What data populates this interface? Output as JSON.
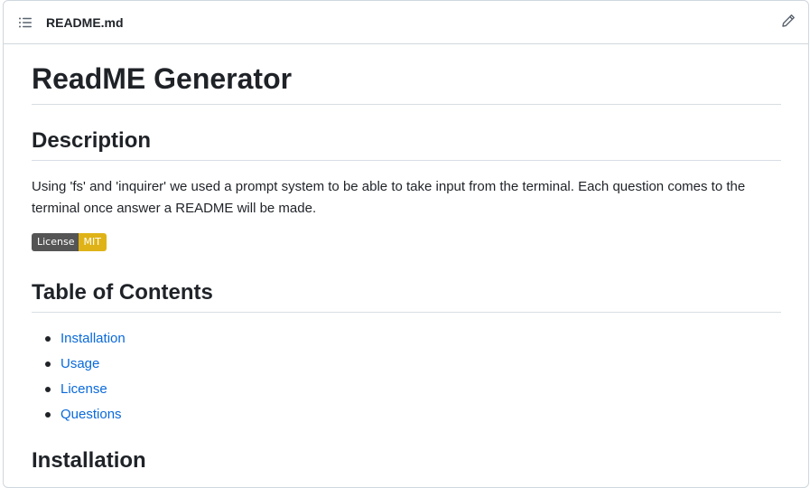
{
  "file_header": {
    "file_name": "README.md",
    "list_icon": "list-unordered-icon",
    "edit_icon": "pencil-icon"
  },
  "readme": {
    "title": "ReadME Generator",
    "description_heading": "Description",
    "description_text": "Using 'fs' and 'inquirer' we used a prompt system to be able to take input from the terminal. Each question comes to the terminal once answer a README will be made.",
    "badge": {
      "label": "License",
      "value": "MIT",
      "label_color": "#555555",
      "value_color": "#dfb317"
    },
    "toc_heading": "Table of Contents",
    "toc_items": [
      {
        "label": "Installation"
      },
      {
        "label": "Usage"
      },
      {
        "label": "License"
      },
      {
        "label": "Questions"
      }
    ],
    "installation_heading": "Installation"
  },
  "colors": {
    "link": "#0969da",
    "text": "#1f2328",
    "border": "#d0d7de"
  }
}
